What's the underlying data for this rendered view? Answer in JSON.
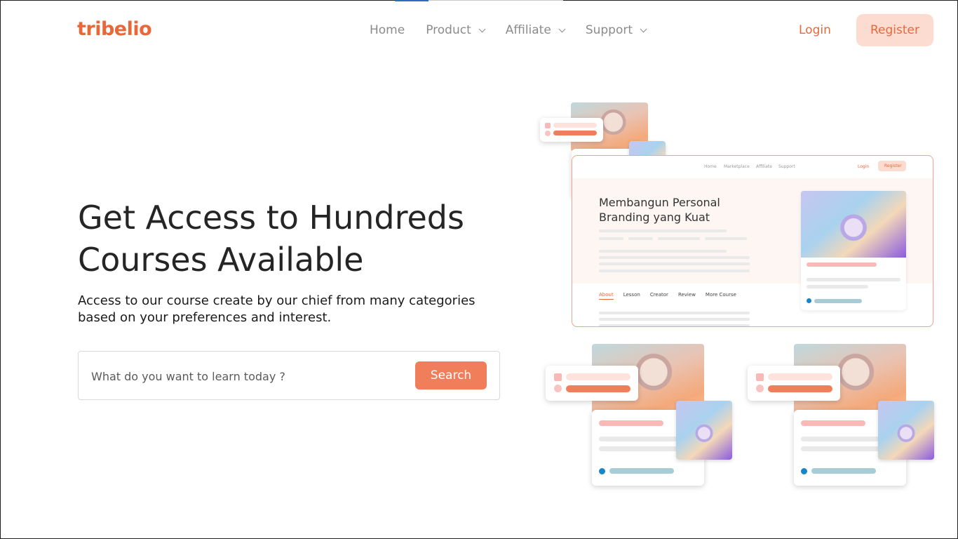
{
  "brand": {
    "logo_text": "tribelio",
    "accent": "#e9683a",
    "button_fill": "#f07e5a",
    "register_fill": "#fcdcd1"
  },
  "nav": {
    "items": [
      {
        "label": "Home",
        "has_dropdown": false
      },
      {
        "label": "Product",
        "has_dropdown": true
      },
      {
        "label": "Affiliate",
        "has_dropdown": true
      },
      {
        "label": "Support",
        "has_dropdown": true
      }
    ],
    "login_label": "Login",
    "register_label": "Register"
  },
  "hero": {
    "title": "Get Access to Hundreds Courses Available",
    "subtitle": "Access to our course create by our chief from many categories based on your preferences and interest.",
    "search": {
      "placeholder": "What do you want to learn today ?",
      "button_label": "Search"
    }
  },
  "illustration": {
    "mini_nav": [
      "Home",
      "Marketplace",
      "Affiliate",
      "Support"
    ],
    "mini_login": "Login",
    "mini_register": "Register",
    "course_title": "Membangun Personal Branding yang Kuat",
    "tabs": [
      "About",
      "Lesson",
      "Creator",
      "Review",
      "More Course"
    ]
  }
}
